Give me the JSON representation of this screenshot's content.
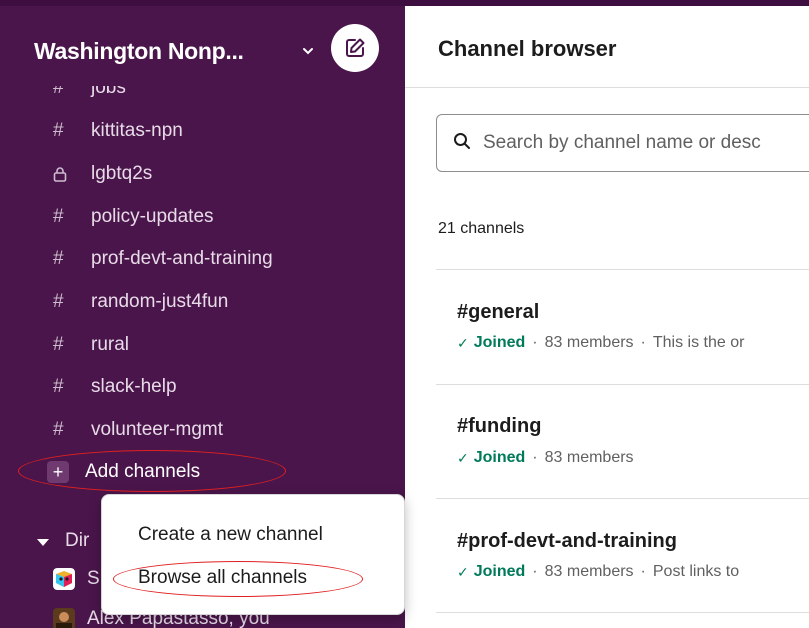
{
  "sidebar": {
    "workspace_name": "Washington Nonp...",
    "channels": [
      {
        "prefix": "#",
        "name": "jobs"
      },
      {
        "prefix": "#",
        "name": "kittitas-npn"
      },
      {
        "prefix": "lock",
        "name": "lgbtq2s"
      },
      {
        "prefix": "#",
        "name": "policy-updates"
      },
      {
        "prefix": "#",
        "name": "prof-devt-and-training"
      },
      {
        "prefix": "#",
        "name": "random-just4fun"
      },
      {
        "prefix": "#",
        "name": "rural"
      },
      {
        "prefix": "#",
        "name": "slack-help"
      },
      {
        "prefix": "#",
        "name": "volunteer-mgmt"
      }
    ],
    "add_channels_label": "Add channels",
    "dm_section_label": "Dir",
    "dm_items": [
      {
        "name": "S",
        "avatar": "slackbot-icon"
      },
      {
        "name": "Alex Papastasso, you",
        "avatar": "person-avatar"
      }
    ]
  },
  "popup_menu": {
    "items": [
      "Create a new channel",
      "Browse all channels"
    ]
  },
  "main": {
    "title": "Channel browser",
    "search_placeholder": "Search by channel name or desc",
    "channel_count": "21 channels",
    "channels": [
      {
        "name": "#general",
        "joined": "Joined",
        "members": "83 members",
        "description": "This is the or"
      },
      {
        "name": "#funding",
        "joined": "Joined",
        "members": "83 members",
        "description": ""
      },
      {
        "name": "#prof-devt-and-training",
        "joined": "Joined",
        "members": "83 members",
        "description": "Post links to"
      }
    ]
  },
  "colors": {
    "sidebar_bg": "#4a154b",
    "joined_green": "#007a5a",
    "annotation_red": "#e02020"
  }
}
